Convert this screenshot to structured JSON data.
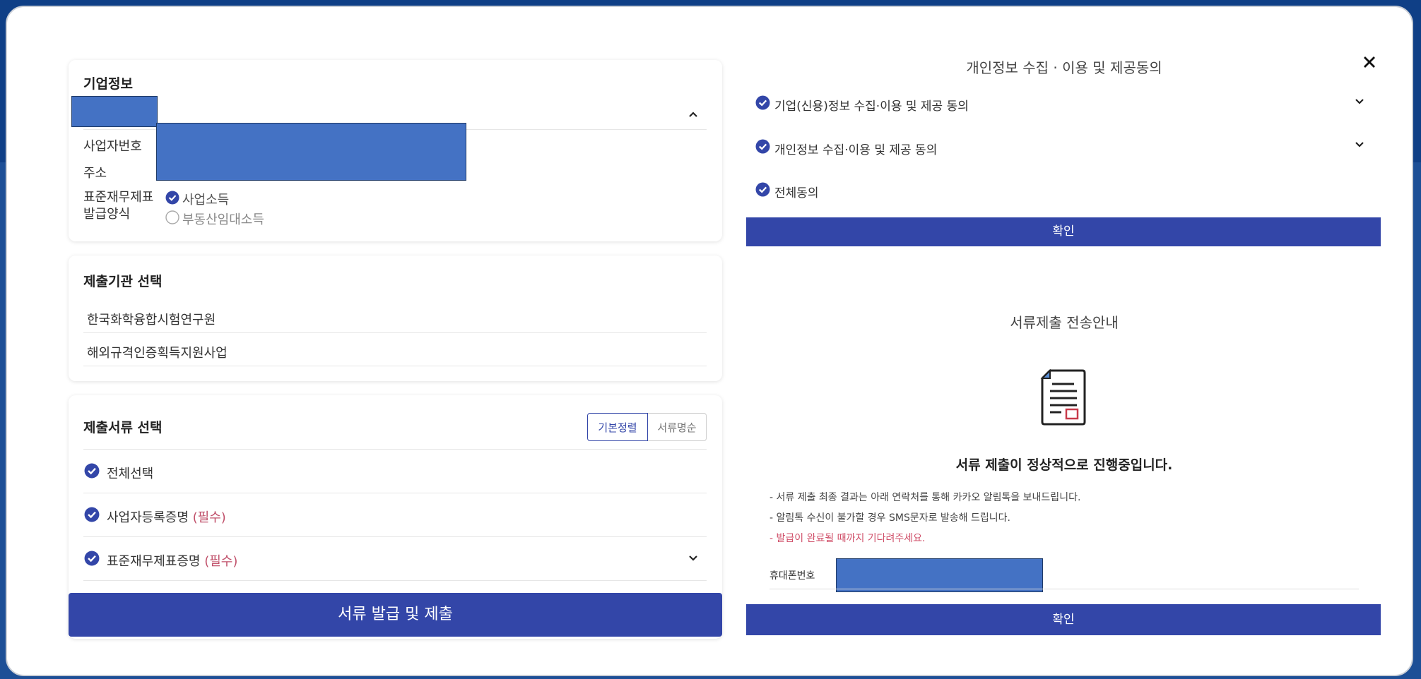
{
  "company_info": {
    "title": "기업정보",
    "business_number_label": "사업자번호",
    "address_label": "주소",
    "issue_format_label_line1": "표준재무제표",
    "issue_format_label_line2": "발급양식",
    "option_business_income": "사업소득",
    "option_real_estate_income": "부동산임대소득"
  },
  "institution": {
    "title": "제출기관 선택",
    "items": [
      "한국화학융합시험연구원",
      "해외규격인증획득지원사업"
    ]
  },
  "documents": {
    "title": "제출서류 선택",
    "sort_default": "기본정렬",
    "sort_by_name": "서류명순",
    "select_all": "전체선택",
    "item1": "사업자등록증명",
    "item2": "표준재무제표증명",
    "required_tag": "(필수)",
    "submit_button": "서류 발급 및 제출"
  },
  "consent_modal": {
    "title": "개인정보 수집 · 이용 및 제공동의",
    "item1": "기업(신용)정보 수집·이용 및 제공 동의",
    "item2": "개인정보 수집·이용 및 제공 동의",
    "agree_all": "전체동의",
    "confirm": "확인"
  },
  "transmission": {
    "title": "서류제출 전송안내",
    "status": "서류 제출이 정상적으로 진행중입니다.",
    "note1": "- 서류 제출 최종 결과는 아래 연락처를 통해 카카오 알림톡을 보내드립니다.",
    "note2": "- 알림톡 수신이 불가할 경우 SMS문자로 발송해 드립니다.",
    "note3": "- 발급이 완료될 때까지 기다려주세요.",
    "phone_label": "휴대폰번호",
    "confirm": "확인"
  },
  "colors": {
    "accent": "#3346a8",
    "redaction": "#4472c4",
    "required": "#c0506a"
  }
}
